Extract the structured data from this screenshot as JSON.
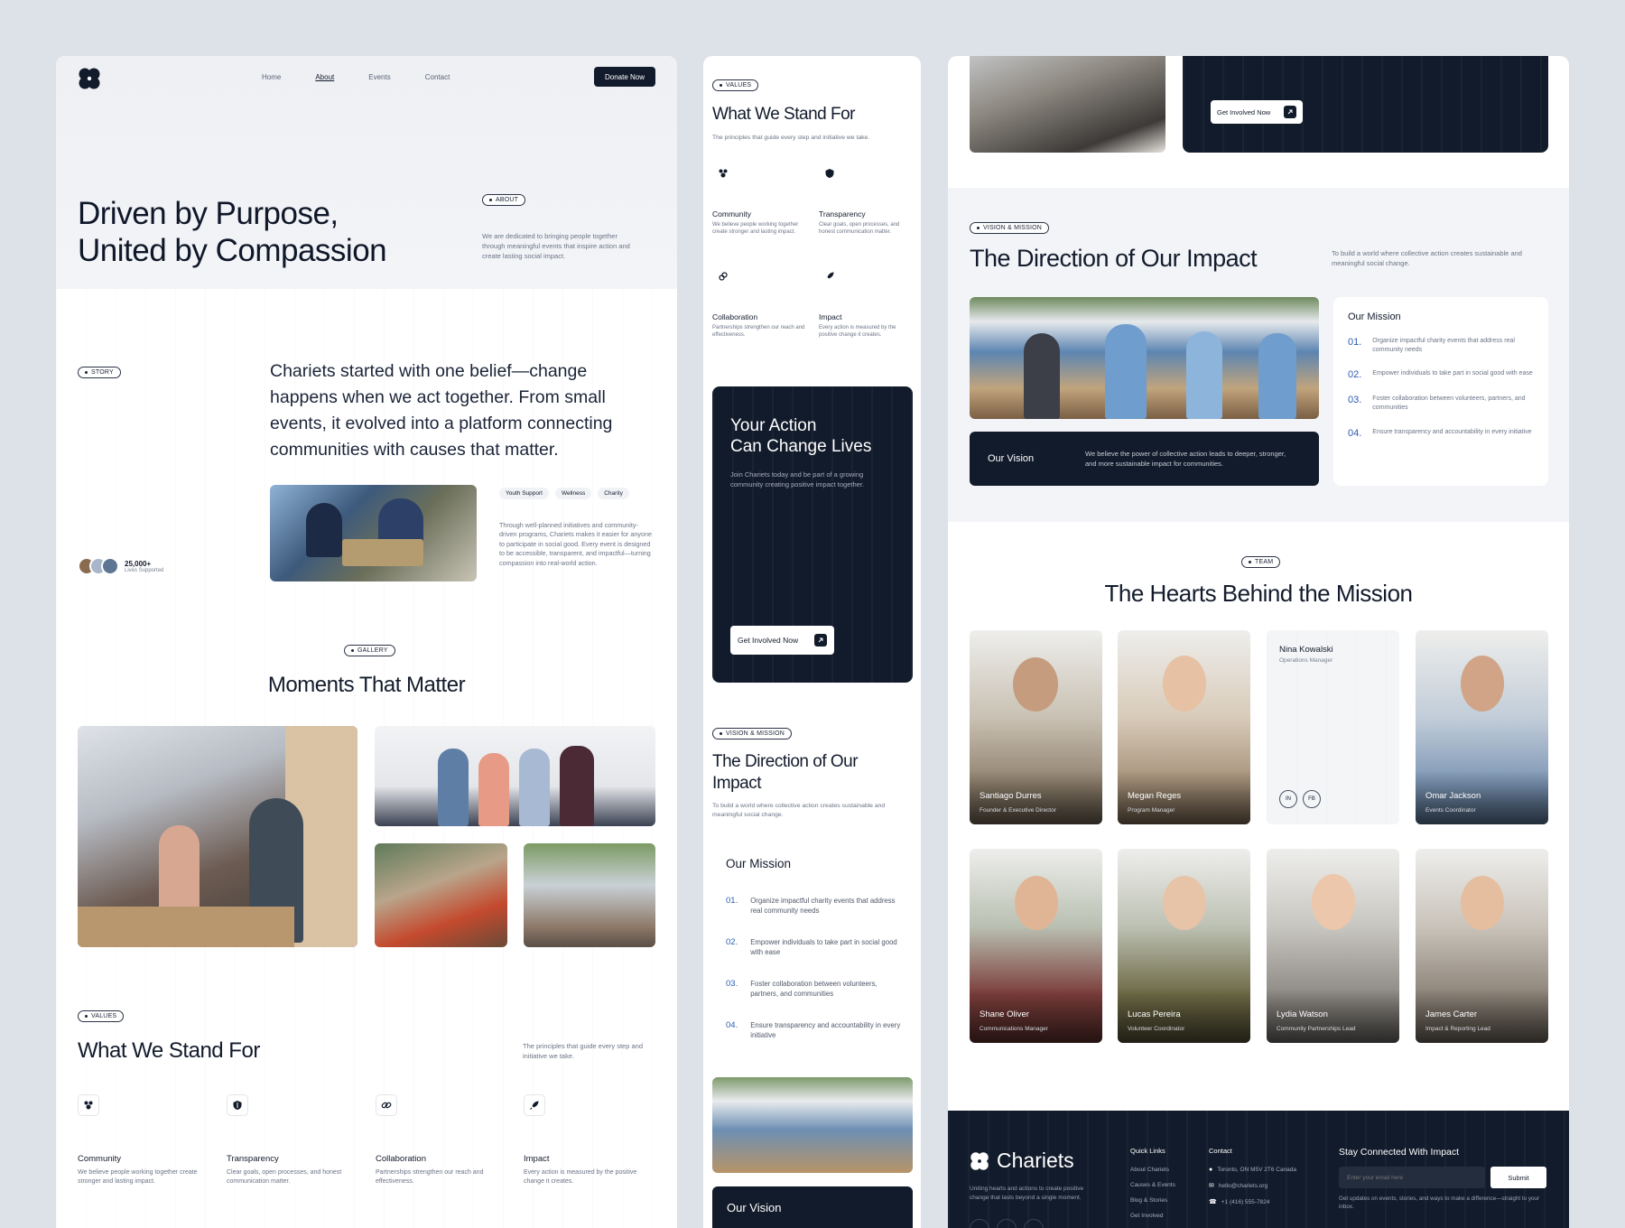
{
  "about_page": {
    "nav": {
      "home": "Home",
      "about": "About",
      "events": "Events",
      "contact": "Contact",
      "donate": "Donate Now"
    },
    "hero": {
      "title_line1": "Driven by Purpose,",
      "title_line2": "United by Compassion",
      "badge": "ABOUT",
      "text": "We are dedicated to bringing people together through meaningful events that inspire action and create lasting social impact."
    },
    "story": {
      "badge": "STORY",
      "headline": "Chariets started with one belief—change happens when we act together. From small events, it evolved into a platform connecting communities with causes that matter.",
      "tags": [
        "Youth Support",
        "Wellness",
        "Charity"
      ],
      "text": "Through well-planned initiatives and community-driven programs, Chariets makes it easier for anyone to participate in social good. Every event is designed to be accessible, transparent, and impactful—turning compassion into real-world action.",
      "stat_value": "25,000+",
      "stat_label": "Lives Supported"
    },
    "gallery": {
      "badge": "GALLERY",
      "title": "Moments That Matter"
    },
    "values": {
      "badge": "VALUES",
      "title": "What We Stand For",
      "subtitle": "The principles that guide every step and initiative we take.",
      "items": [
        {
          "title": "Community",
          "text": "We believe people working together create stronger and lasting impact.",
          "icon": "people-icon"
        },
        {
          "title": "Transparency",
          "text": "Clear goals, open processes, and honest communication matter.",
          "icon": "shield-icon"
        },
        {
          "title": "Collaboration",
          "text": "Partnerships strengthen our reach and effectiveness.",
          "icon": "link-icon"
        },
        {
          "title": "Impact",
          "text": "Every action is measured by the positive change it creates.",
          "icon": "rocket-icon"
        }
      ]
    }
  },
  "mobile_page": {
    "values_badge": "VALUES",
    "values_title": "What We Stand For",
    "values_subtitle": "The principles that guide every step and initiative we take.",
    "values": [
      {
        "title": "Community",
        "text": "We believe people working together create stronger and lasting impact."
      },
      {
        "title": "Transparency",
        "text": "Clear goals, open processes, and honest communication matter."
      },
      {
        "title": "Collaboration",
        "text": "Partnerships strengthen our reach and effectiveness."
      },
      {
        "title": "Impact",
        "text": "Every action is measured by the positive change it creates."
      }
    ],
    "cta": {
      "title_line1": "Your Action",
      "title_line2": "Can Change Lives",
      "text": "Join Chariets today and be part of a growing community creating positive impact together.",
      "button": "Get Involved Now"
    },
    "vm_badge": "VISION & MISSION",
    "vm_title": "The Direction of Our Impact",
    "vm_text": "To build a world where collective action creates sustainable and meaningful social change.",
    "mission_title": "Our Mission",
    "mission": [
      {
        "num": "01.",
        "text": "Organize impactful charity events that address real community needs"
      },
      {
        "num": "02.",
        "text": "Empower individuals to take part in social good with ease"
      },
      {
        "num": "03.",
        "text": "Foster collaboration between volunteers, partners, and communities"
      },
      {
        "num": "04.",
        "text": "Ensure transparency and accountability in every initiative"
      }
    ],
    "vision_title": "Our Vision"
  },
  "team_page": {
    "cta_button": "Get Involved Now",
    "vm_badge": "VISION & MISSION",
    "vm_title": "The Direction of Our Impact",
    "vm_text": "To build a world where collective action creates sustainable and meaningful social change.",
    "mission_title": "Our Mission",
    "mission": [
      {
        "num": "01.",
        "text": "Organize impactful charity events that address real community needs"
      },
      {
        "num": "02.",
        "text": "Empower individuals to take part in social good with ease"
      },
      {
        "num": "03.",
        "text": "Foster collaboration between volunteers, partners, and communities"
      },
      {
        "num": "04.",
        "text": "Ensure transparency and accountability in every initiative"
      }
    ],
    "vision_title": "Our Vision",
    "vision_text": "We believe the power of collective action leads to deeper, stronger, and more sustainable impact for communities.",
    "team_badge": "TEAM",
    "team_title": "The Hearts Behind the Mission",
    "members": [
      {
        "name": "Santiago Durres",
        "role": "Founder & Executive Director"
      },
      {
        "name": "Megan Reges",
        "role": "Program Manager"
      },
      {
        "name": "Nina Kowalski",
        "role": "Operations Manager"
      },
      {
        "name": "Omar Jackson",
        "role": "Events Coordinator"
      },
      {
        "name": "Shane Oliver",
        "role": "Communications Manager"
      },
      {
        "name": "Lucas Pereira",
        "role": "Volunteer Coordinator"
      },
      {
        "name": "Lydia Watson",
        "role": "Community Partnerships Lead"
      },
      {
        "name": "James Carter",
        "role": "Impact & Reporting Lead"
      }
    ],
    "social": {
      "in": "IN",
      "fb": "FB"
    },
    "footer": {
      "brand": "Chariets",
      "tagline": "Uniting hearts and actions to create positive change that lasts beyond a single moment.",
      "quick_links_title": "Quick Links",
      "quick_links": [
        "About Chariets",
        "Causes & Events",
        "Blog & Stories",
        "Get Involved"
      ],
      "contact_title": "Contact",
      "contact": [
        "Toronto, ON M5V 2T6 Canada",
        "hello@chariets.org",
        "+1 (416) 555-7824"
      ],
      "newsletter_title": "Stay Connected With Impact",
      "email_placeholder": "Enter your email here",
      "submit": "Submit",
      "newsletter_text": "Get updates on events, stories, and ways to make a difference—straight to your inbox."
    }
  },
  "colors": {
    "navy": "#121b2b",
    "accent_blue": "#2a5db0",
    "background": "#dde1e8"
  }
}
